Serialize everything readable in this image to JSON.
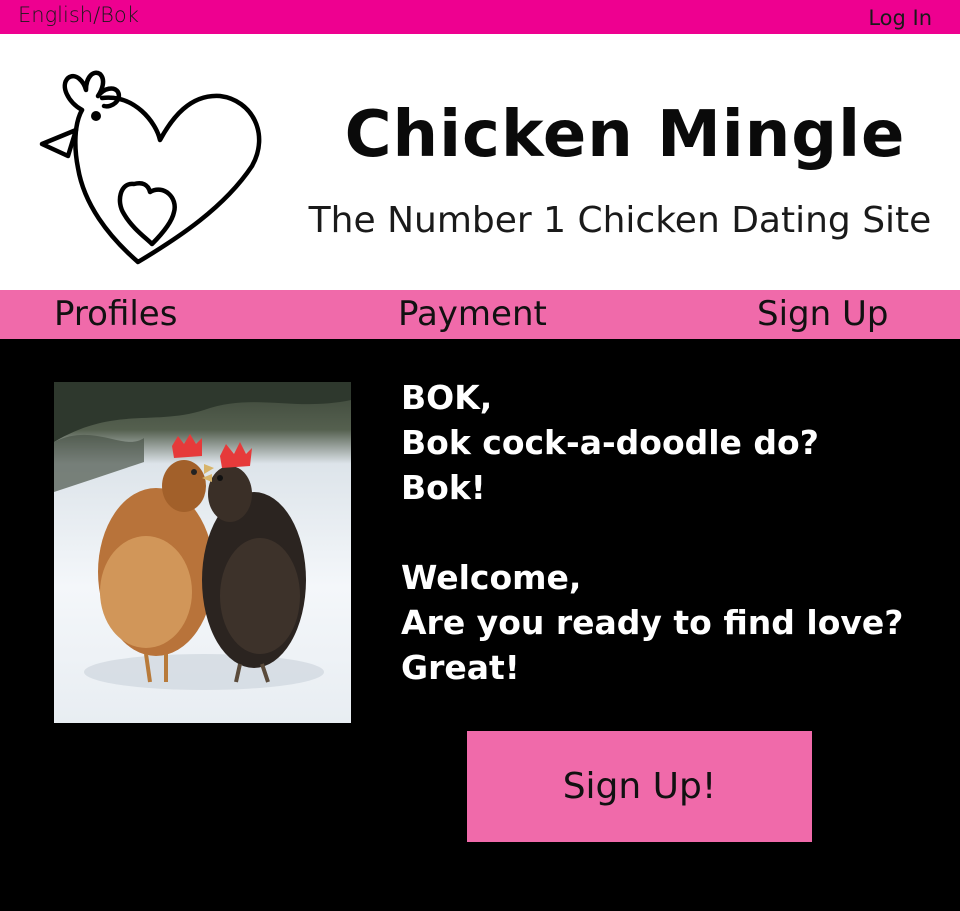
{
  "topbar": {
    "language_label": "English/Bok",
    "login_label": "Log In"
  },
  "header": {
    "site_title": "Chicken Mingle",
    "tagline": "The Number 1 Chicken Dating Site",
    "logo_icon": "chicken-heart-logo"
  },
  "nav": {
    "items": [
      {
        "label": "Profiles"
      },
      {
        "label": "Payment"
      },
      {
        "label": "Sign Up"
      }
    ]
  },
  "main": {
    "photo_icon": "two-chickens-in-snow-photo",
    "lines": [
      "BOK,",
      "Bok cock-a-doodle do?",
      "Bok!",
      "Welcome,",
      "Are you ready to find love?",
      "Great!"
    ],
    "cta_label": "Sign Up!"
  },
  "colors": {
    "topbar": "#ee0090",
    "nav": "#f06aaa",
    "background": "#000000",
    "header": "#ffffff"
  }
}
